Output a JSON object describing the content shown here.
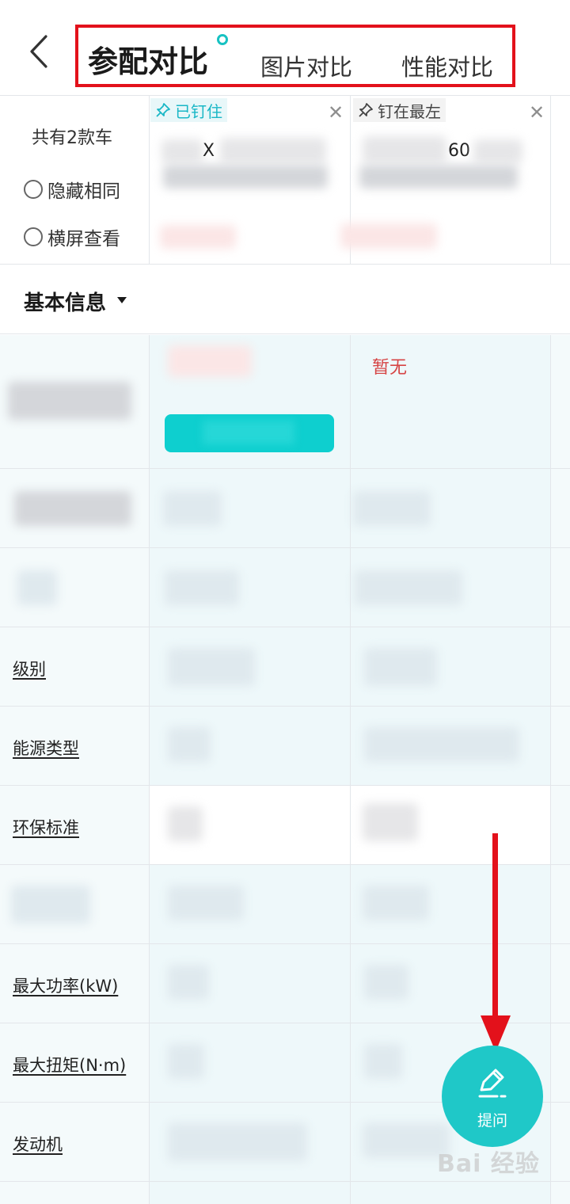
{
  "header": {
    "tabs": [
      {
        "label": "参配对比",
        "active": true
      },
      {
        "label": "图片对比",
        "active": false
      },
      {
        "label": "性能对比",
        "active": false
      }
    ]
  },
  "compare": {
    "car_count": "共有2款车",
    "options": [
      {
        "label": "隐藏相同"
      },
      {
        "label": "横屏查看"
      }
    ],
    "cars": [
      {
        "pin_label": "已钉住",
        "name_fragment": "X"
      },
      {
        "pin_label": "钉在最左",
        "name_fragment": "60"
      }
    ]
  },
  "section": {
    "title": "基本信息"
  },
  "table": {
    "no_data": "暂无",
    "row_labels": [
      "级别",
      "能源类型",
      "环保标准",
      "最大功率(kW)",
      "最大扭矩(N·m)",
      "发动机"
    ]
  },
  "fab": {
    "label": "提问",
    "icon": "edit-icon"
  },
  "watermark": {
    "main": "Bai 经验"
  },
  "colors": {
    "accent": "#1fc8c8",
    "annotation": "#e3111b",
    "no_data": "#d64545"
  }
}
